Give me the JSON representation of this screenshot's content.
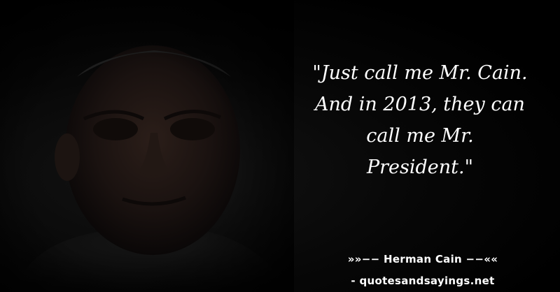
{
  "quote": {
    "lines": [
      "\"Just call me Mr. Cain.",
      "And in 2013, they can",
      "call me Mr.",
      "President.\""
    ]
  },
  "attribution": "»»−− Herman Cain −−««",
  "source": "- quotesandsayings.net",
  "colors": {
    "background": "#000000",
    "text": "#ffffff"
  }
}
